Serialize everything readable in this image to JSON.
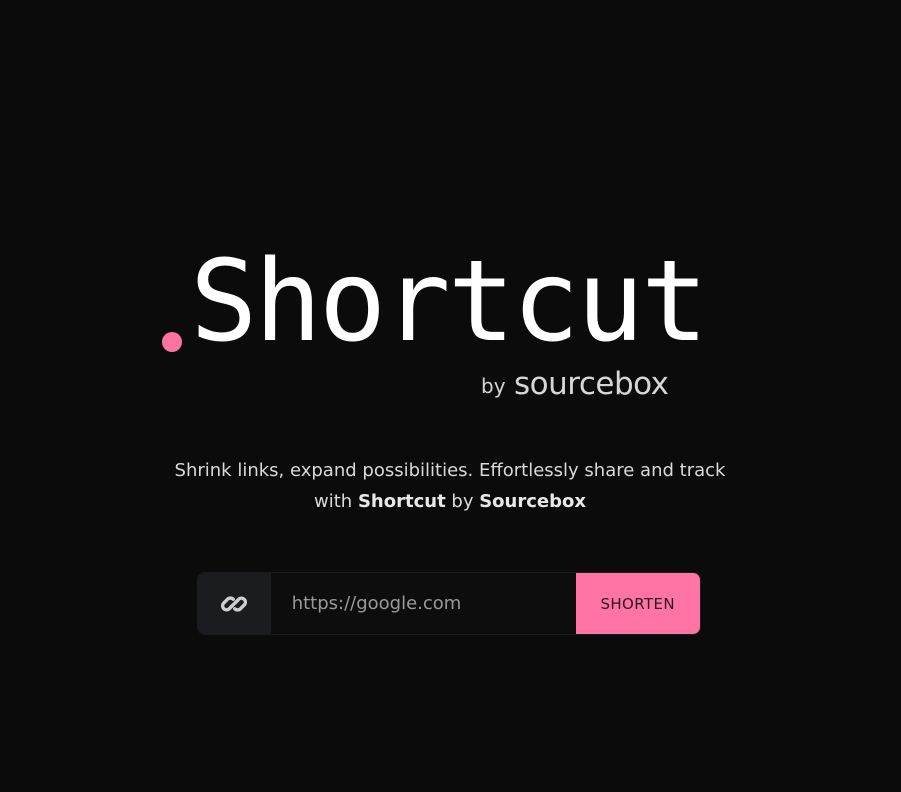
{
  "logo": {
    "dot": ".",
    "word": "Shortcut",
    "by": "by",
    "brand": "sourcebox"
  },
  "tagline": {
    "line1": "Shrink links, expand possibilities. Effortlessly share and track",
    "with": "with",
    "shortcut": "Shortcut",
    "by": "by",
    "sourcebox": "Sourcebox"
  },
  "form": {
    "link_icon": "link-icon",
    "input_placeholder": "https://google.com",
    "input_value": "",
    "button_label": "SHORTEN"
  },
  "colors": {
    "background": "#0b0b0b",
    "accent": "#ff74a4",
    "text": "#ffffff"
  }
}
